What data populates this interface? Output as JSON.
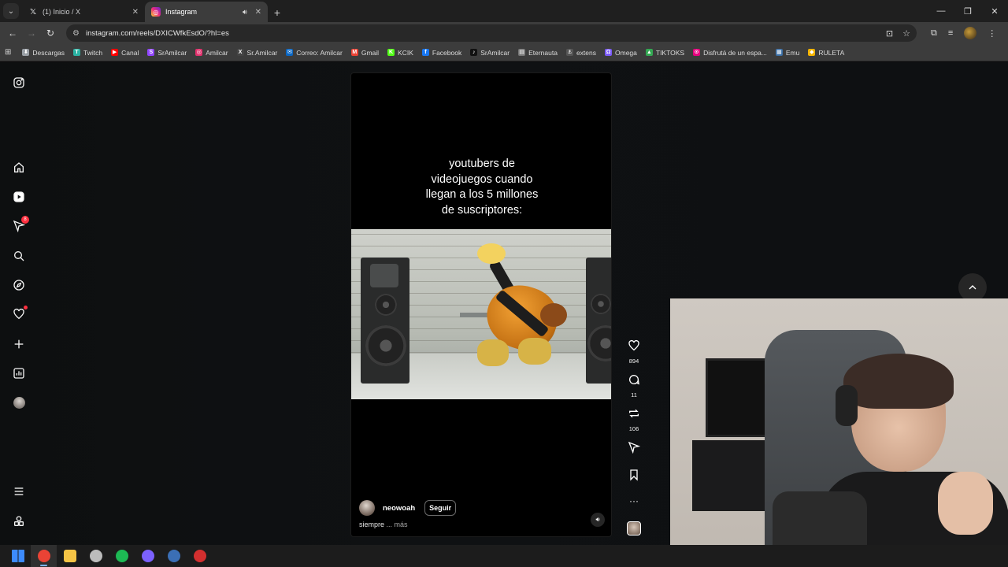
{
  "browser": {
    "tabs": [
      {
        "title": "(1) Inicio / X",
        "favicon": "x-logo-icon",
        "active": false
      },
      {
        "title": "Instagram",
        "favicon": "instagram-icon",
        "active": true
      }
    ],
    "url": "instagram.com/reels/DXICWfkEsdO/?hl=es",
    "bookmarks": [
      {
        "label": "Descargas",
        "color": "#9aa0a6",
        "glyph": "⬇"
      },
      {
        "label": "Twitch",
        "color": "#2bb3a3",
        "glyph": "T"
      },
      {
        "label": "Canal",
        "color": "#ff0000",
        "glyph": "▶"
      },
      {
        "label": "SrAmilcar",
        "color": "#9146ff",
        "glyph": "S"
      },
      {
        "label": "Amilcar",
        "color": "#e1306c",
        "glyph": "◎"
      },
      {
        "label": "Sr.Amilcar",
        "color": "#444444",
        "glyph": "X"
      },
      {
        "label": "Correo: Amilcar",
        "color": "#0a66c2",
        "glyph": "✉"
      },
      {
        "label": "Gmail",
        "color": "#ea4335",
        "glyph": "M"
      },
      {
        "label": "KCIK",
        "color": "#53fc18",
        "glyph": "K"
      },
      {
        "label": "Facebook",
        "color": "#1877f2",
        "glyph": "f"
      },
      {
        "label": "SrAmilcar",
        "color": "#111111",
        "glyph": "♪"
      },
      {
        "label": "Eternauta",
        "color": "#777777",
        "glyph": "▤"
      },
      {
        "label": "extens",
        "color": "#555555",
        "glyph": "⚓"
      },
      {
        "label": "Omega",
        "color": "#7a5af8",
        "glyph": "Ω"
      },
      {
        "label": "TIKTOKS",
        "color": "#34a853",
        "glyph": "▲"
      },
      {
        "label": "Disfrutá de un espa...",
        "color": "#e6007e",
        "glyph": "⊙"
      },
      {
        "label": "Emu",
        "color": "#3a6ea5",
        "glyph": "▦"
      },
      {
        "label": "RULETA",
        "color": "#f4b400",
        "glyph": "◆"
      }
    ]
  },
  "instagram": {
    "sidebar_icons": [
      "instagram-logo-icon",
      "home-icon",
      "reels-icon",
      "direct-messages-icon",
      "search-icon",
      "explore-icon",
      "notifications-icon",
      "create-icon",
      "dashboard-icon",
      "profile-icon",
      "more-menu-icon",
      "threads-icon"
    ],
    "messages_badge": "8",
    "reel": {
      "caption_lines": [
        "youtubers de",
        "videojuegos cuando",
        "llegan a los 5 millones",
        "de suscriptores:"
      ],
      "likes": "894",
      "comments": "11",
      "reposts": "106",
      "author": "neowoah",
      "follow_label": "Seguir",
      "description": "siempre",
      "more_label": "... más"
    }
  },
  "taskbar": {
    "apps": [
      {
        "name": "start",
        "color": "#3d8bfd"
      },
      {
        "name": "chrome",
        "color": "#ea4335",
        "active": true
      },
      {
        "name": "file-explorer",
        "color": "#f6c445"
      },
      {
        "name": "obs",
        "color": "#bcbcbc"
      },
      {
        "name": "spotify",
        "color": "#1db954"
      },
      {
        "name": "discord",
        "color": "#7b61ff"
      },
      {
        "name": "steam",
        "color": "#3b6fb6"
      },
      {
        "name": "record",
        "color": "#d32f2f"
      }
    ]
  }
}
